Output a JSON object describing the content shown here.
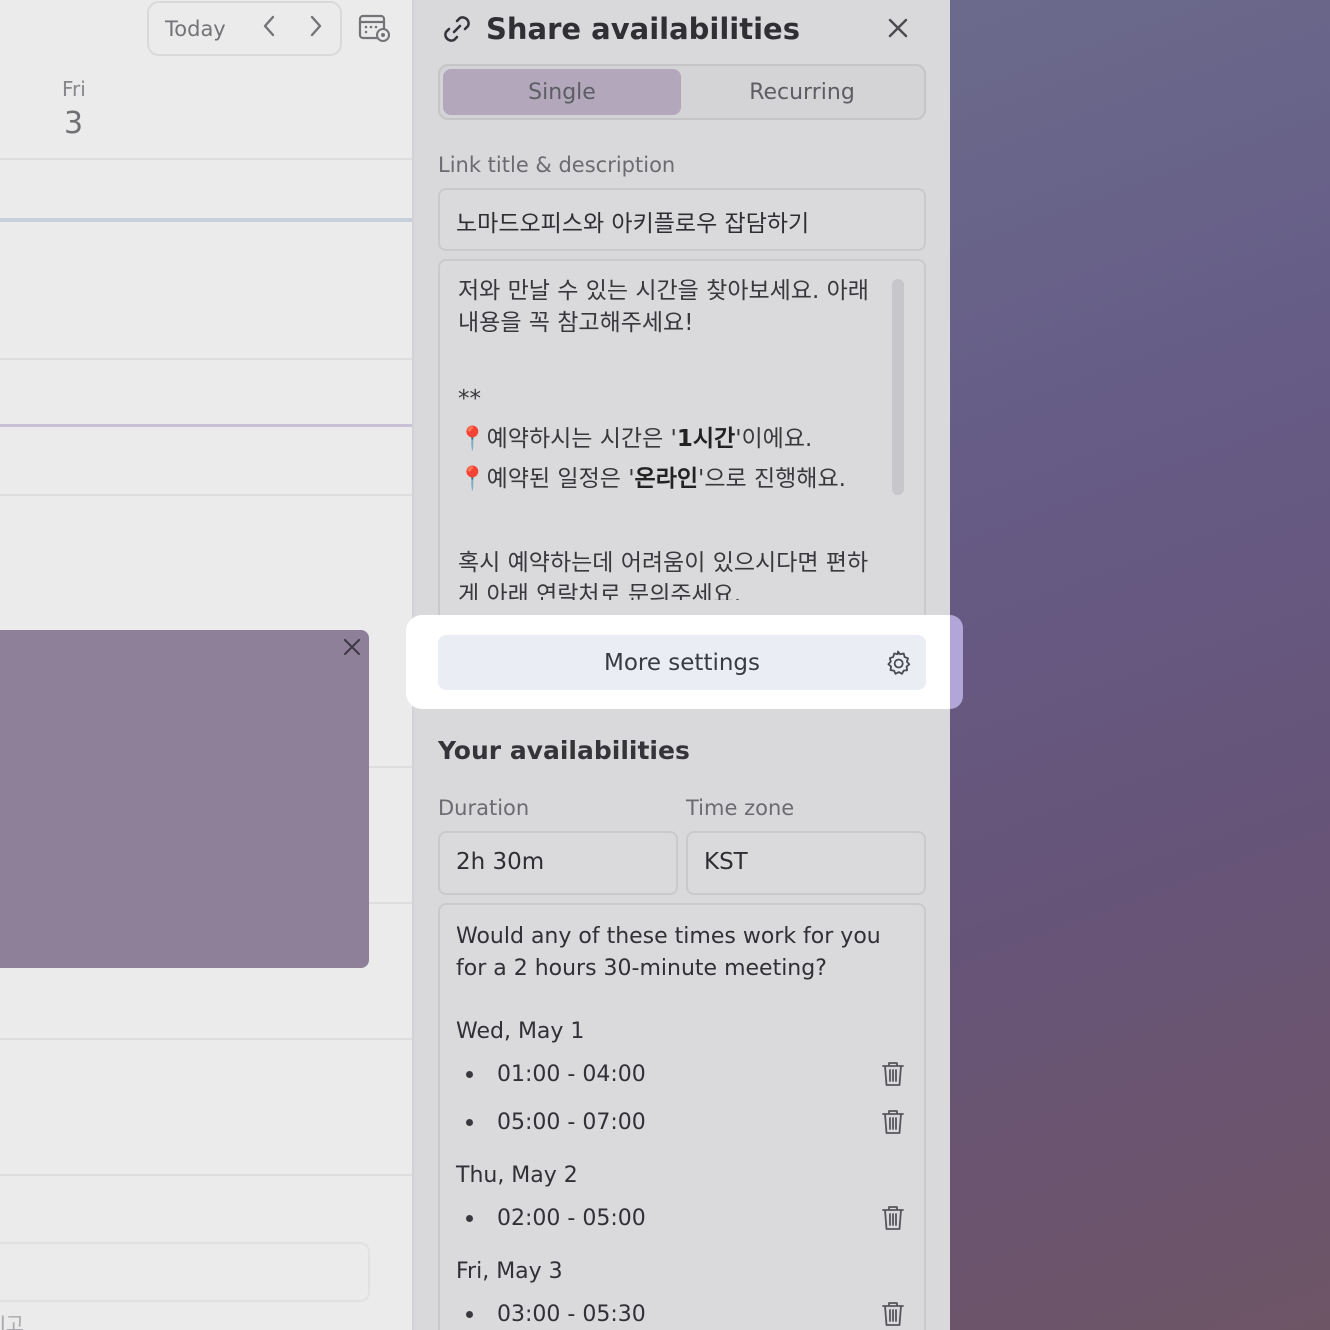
{
  "calendar": {
    "today_label": "Today",
    "prev_icon": "chevron-left-icon",
    "next_icon": "chevron-right-icon",
    "day_name": "Fri",
    "day_number": "3",
    "partial_text": "l고"
  },
  "panel": {
    "title": "Share availabilities",
    "link_icon": "link-icon",
    "close_icon": "close-icon",
    "tabs": [
      {
        "label": "Single",
        "active": true
      },
      {
        "label": "Recurring",
        "active": false
      }
    ],
    "link_label": "Link title & description",
    "link_title": "노마드오피스와 아키플로우 잡담하기",
    "description": {
      "line1": "저와 만날 수 있는 시간을 찾아보세요. 아래 내용을 꼭 참고해주세요!",
      "stars": "**",
      "pin1_pre": "예약하시는 시간은 '",
      "pin1_bold": "1시간",
      "pin1_post": "'이에요.",
      "pin2_pre": "예약된 일정은 '",
      "pin2_bold": "온라인",
      "pin2_post": "'으로 진행해요.",
      "line_last": "혹시 예약하는데 어려움이 있으시다면 편하게 아래 연락처로 문의주세요."
    },
    "more_settings": "More settings",
    "availabilities_title": "Your availabilities",
    "duration_label": "Duration",
    "duration_value": "2h 30m",
    "timezone_label": "Time zone",
    "timezone_value": "KST",
    "intro": "Would any of these times work for you for a 2 hours 30-minute meeting?",
    "days": [
      {
        "date": "Wed, May 1",
        "slots": [
          "01:00 - 04:00",
          "05:00 - 07:00"
        ]
      },
      {
        "date": "Thu, May 2",
        "slots": [
          "02:00 - 05:00"
        ]
      },
      {
        "date": "Fri, May 3",
        "slots": [
          "03:00 - 05:30"
        ]
      }
    ]
  },
  "colors": {
    "highlight_accent": "#b2a5d8",
    "active_tab": "#b3a7bc",
    "event_block": "#8e8099"
  }
}
